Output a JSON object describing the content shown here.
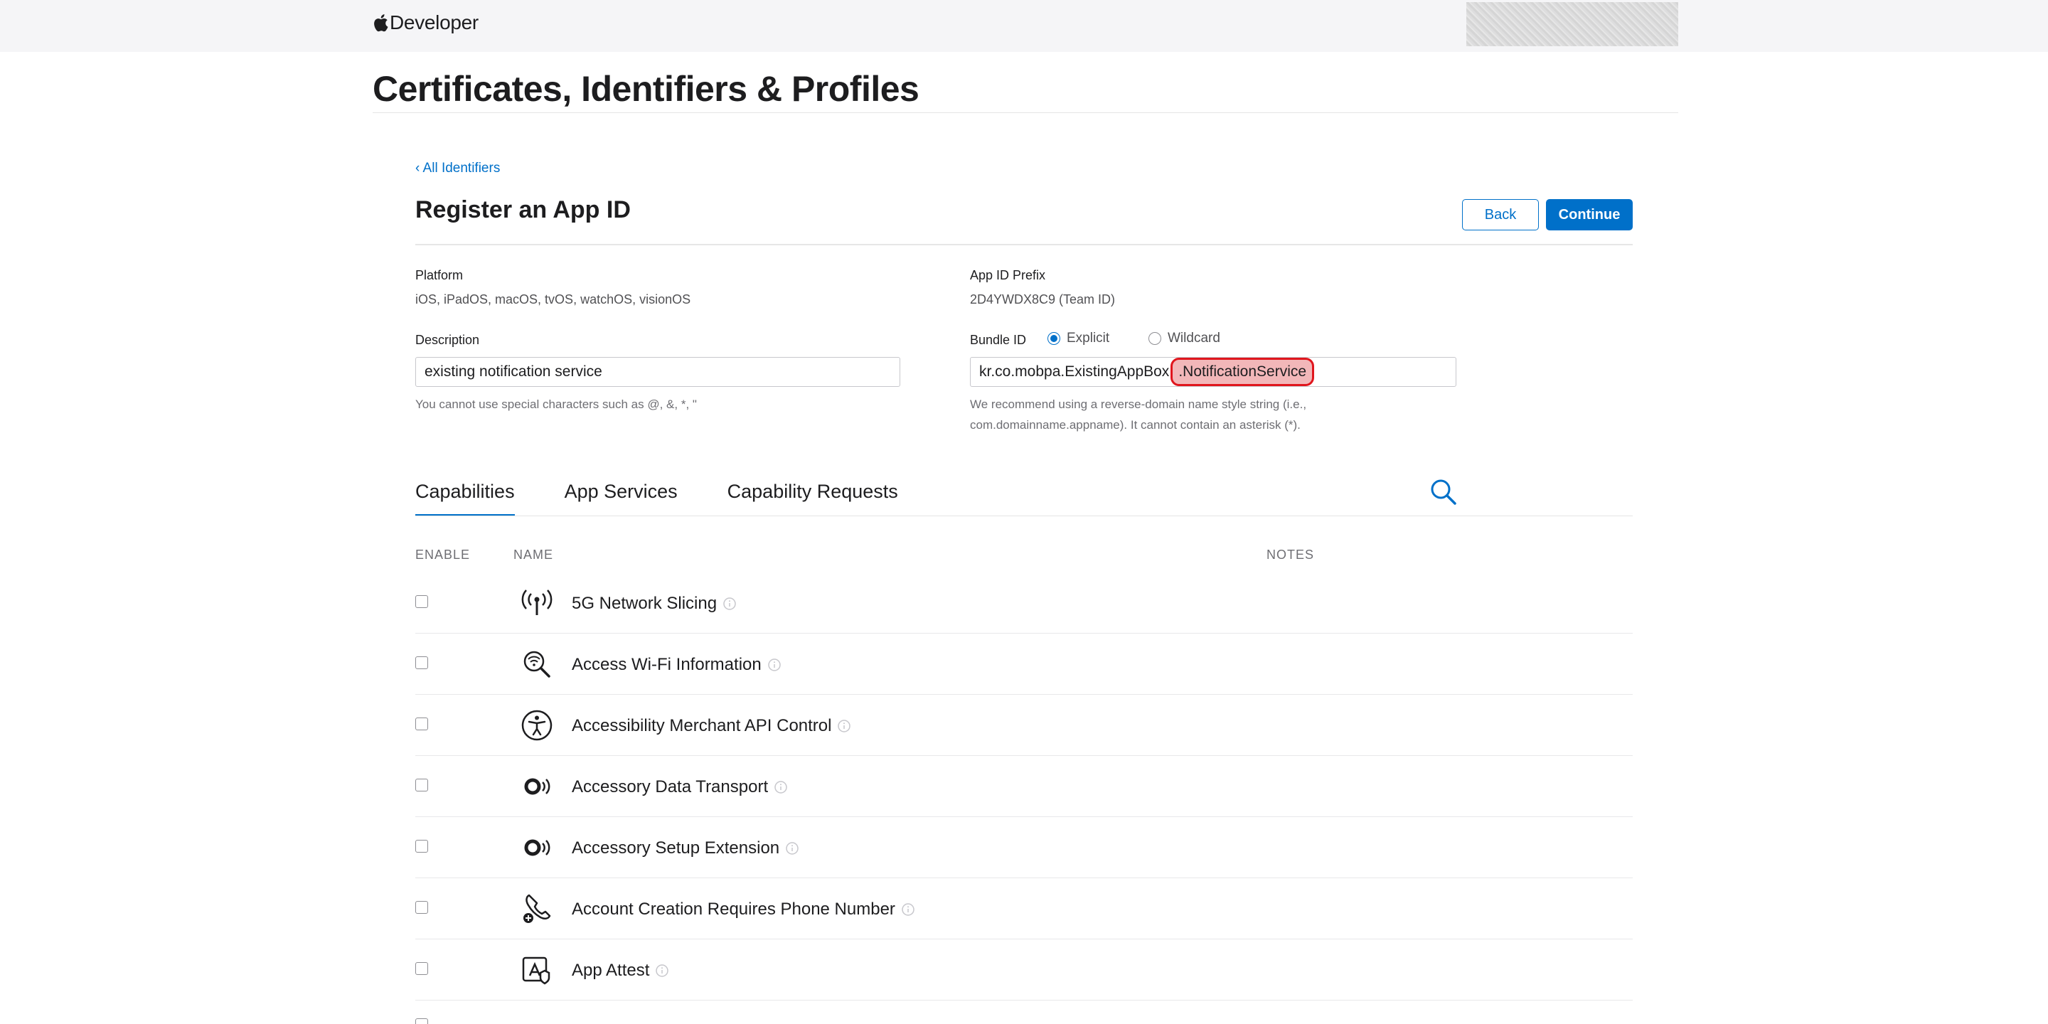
{
  "header": {
    "brand": "Developer",
    "page_title": "Certificates, Identifiers & Profiles"
  },
  "register": {
    "back_link": "‹ All Identifiers",
    "title": "Register an App ID",
    "back_button": "Back",
    "continue_button": "Continue"
  },
  "platform": {
    "label": "Platform",
    "value": "iOS, iPadOS, macOS, tvOS, watchOS, visionOS"
  },
  "app_id_prefix": {
    "label": "App ID Prefix",
    "value": "2D4YWDX8C9 (Team ID)"
  },
  "description": {
    "label": "Description",
    "value": "existing notification service",
    "helper": "You cannot use special characters such as @, &, *, \""
  },
  "bundle_id": {
    "label": "Bundle ID",
    "explicit_label": "Explicit",
    "wildcard_label": "Wildcard",
    "selected": "Explicit",
    "value_prefix": "kr.co.mobpa.ExistingAppBox",
    "value_highlighted": ".NotificationService",
    "helper_line1": "We recommend using a reverse-domain name style string (i.e.,",
    "helper_line2": "com.domainname.appname). It cannot contain an asterisk (*).",
    "highlight_color": "#e0161d"
  },
  "tabs": [
    {
      "label": "Capabilities",
      "active": true
    },
    {
      "label": "App Services",
      "active": false
    },
    {
      "label": "Capability Requests",
      "active": false
    }
  ],
  "table": {
    "columns": [
      "ENABLE",
      "NAME",
      "NOTES"
    ],
    "rows": [
      {
        "name": "5G Network Slicing",
        "icon": "antenna-icon",
        "enabled": false
      },
      {
        "name": "Access Wi-Fi Information",
        "icon": "wifi-magnifier-icon",
        "enabled": false
      },
      {
        "name": "Accessibility Merchant API Control",
        "icon": "accessibility-icon",
        "enabled": false
      },
      {
        "name": "Accessory Data Transport",
        "icon": "accessory-signal-icon",
        "enabled": false
      },
      {
        "name": "Accessory Setup Extension",
        "icon": "accessory-signal-icon",
        "enabled": false
      },
      {
        "name": "Account Creation Requires Phone Number",
        "icon": "phone-add-icon",
        "enabled": false
      },
      {
        "name": "App Attest",
        "icon": "app-attest-icon",
        "enabled": false
      },
      {
        "name": "",
        "icon": "partial-row-icon",
        "enabled": false
      }
    ]
  },
  "colors": {
    "accent": "#0070c9",
    "topbar": "#f5f5f7"
  }
}
